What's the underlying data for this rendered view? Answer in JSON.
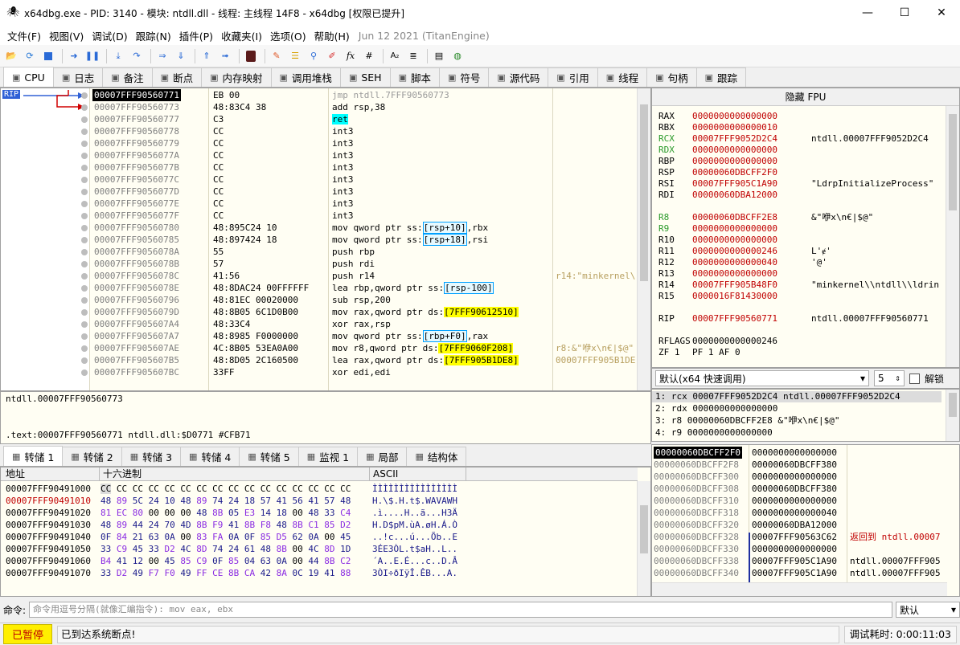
{
  "window": {
    "title": "x64dbg.exe - PID: 3140 - 模块: ntdll.dll - 线程: 主线程 14F8 - x64dbg [权限已提升]",
    "minimize": "—",
    "maximize": "☐",
    "close": "✕"
  },
  "menu": {
    "items": [
      "文件(F)",
      "视图(V)",
      "调试(D)",
      "跟踪(N)",
      "插件(P)",
      "收藏夹(I)",
      "选项(O)",
      "帮助(H)"
    ],
    "date": "Jun 12 2021 (TitanEngine)"
  },
  "toolbar": {
    "icons": [
      "open-icon",
      "restart-icon",
      "stop-icon",
      "run-icon",
      "pause-icon",
      "step-into-icon",
      "step-over-icon",
      "trace-into-icon",
      "trace-over-icon",
      "run-to-user-icon",
      "execute-till-return-icon",
      "scylla-icon",
      "hide-icon",
      "comment-icon",
      "label-icon",
      "bookmark-icon",
      "function-icon",
      "hash-icon",
      "strings-icon",
      "patch-icon",
      "calc-icon"
    ]
  },
  "tabs": [
    {
      "label": "CPU",
      "icon": "cpu-icon"
    },
    {
      "label": "日志",
      "icon": "log-icon"
    },
    {
      "label": "备注",
      "icon": "notes-icon"
    },
    {
      "label": "断点",
      "icon": "breakpoint-icon"
    },
    {
      "label": "内存映射",
      "icon": "memory-icon"
    },
    {
      "label": "调用堆栈",
      "icon": "callstack-icon"
    },
    {
      "label": "SEH",
      "icon": "seh-icon"
    },
    {
      "label": "脚本",
      "icon": "script-icon"
    },
    {
      "label": "符号",
      "icon": "symbol-icon"
    },
    {
      "label": "源代码",
      "icon": "source-icon"
    },
    {
      "label": "引用",
      "icon": "reference-icon"
    },
    {
      "label": "线程",
      "icon": "thread-icon"
    },
    {
      "label": "句柄",
      "icon": "handle-icon"
    },
    {
      "label": "跟踪",
      "icon": "trace-icon"
    }
  ],
  "disasm": {
    "rip_label": "RIP",
    "rows": [
      {
        "addr": "00007FFF90560771",
        "bytes": "EB 00",
        "instr": "jmp ntdll.7FFF90560773",
        "comment": "",
        "cur": true
      },
      {
        "addr": "00007FFF90560773",
        "bytes": "48:83C4 38",
        "instr": "add rsp,38",
        "comment": ""
      },
      {
        "addr": "00007FFF90560777",
        "bytes": "C3",
        "instr": "ret",
        "comment": ""
      },
      {
        "addr": "00007FFF90560778",
        "bytes": "CC",
        "instr": "int3",
        "comment": ""
      },
      {
        "addr": "00007FFF90560779",
        "bytes": "CC",
        "instr": "int3",
        "comment": ""
      },
      {
        "addr": "00007FFF9056077A",
        "bytes": "CC",
        "instr": "int3",
        "comment": ""
      },
      {
        "addr": "00007FFF9056077B",
        "bytes": "CC",
        "instr": "int3",
        "comment": ""
      },
      {
        "addr": "00007FFF9056077C",
        "bytes": "CC",
        "instr": "int3",
        "comment": ""
      },
      {
        "addr": "00007FFF9056077D",
        "bytes": "CC",
        "instr": "int3",
        "comment": ""
      },
      {
        "addr": "00007FFF9056077E",
        "bytes": "CC",
        "instr": "int3",
        "comment": ""
      },
      {
        "addr": "00007FFF9056077F",
        "bytes": "CC",
        "instr": "int3",
        "comment": ""
      },
      {
        "addr": "00007FFF90560780",
        "bytes": "48:895C24 10",
        "instr": "mov qword ptr ss:[rsp+10],rbx",
        "comment": ""
      },
      {
        "addr": "00007FFF90560785",
        "bytes": "48:897424 18",
        "instr": "mov qword ptr ss:[rsp+18],rsi",
        "comment": ""
      },
      {
        "addr": "00007FFF9056078A",
        "bytes": "55",
        "instr": "push rbp",
        "comment": ""
      },
      {
        "addr": "00007FFF9056078B",
        "bytes": "57",
        "instr": "push rdi",
        "comment": ""
      },
      {
        "addr": "00007FFF9056078C",
        "bytes": "41:56",
        "instr": "push r14",
        "comment": "r14:\"minkernel\\"
      },
      {
        "addr": "00007FFF9056078E",
        "bytes": "48:8DAC24 00FFFFFF",
        "instr": "lea rbp,qword ptr ss:[rsp-100]",
        "comment": ""
      },
      {
        "addr": "00007FFF90560796",
        "bytes": "48:81EC 00020000",
        "instr": "sub rsp,200",
        "comment": ""
      },
      {
        "addr": "00007FFF9056079D",
        "bytes": "48:8B05 6C1D0B00",
        "instr": "mov rax,qword ptr ds:[7FFF90612510]",
        "comment": ""
      },
      {
        "addr": "00007FFF905607A4",
        "bytes": "48:33C4",
        "instr": "xor rax,rsp",
        "comment": ""
      },
      {
        "addr": "00007FFF905607A7",
        "bytes": "48:8985 F0000000",
        "instr": "mov qword ptr ss:[rbp+F0],rax",
        "comment": ""
      },
      {
        "addr": "00007FFF905607AE",
        "bytes": "4C:8B05 53EA0A00",
        "instr": "mov r8,qword ptr ds:[7FFF9060F208]",
        "comment": "r8:&\"咿x\\n€|$@\""
      },
      {
        "addr": "00007FFF905607B5",
        "bytes": "48:8D05 2C160500",
        "instr": "lea rax,qword ptr ds:[7FFF905B1DE8]",
        "comment": "00007FFF905B1DE"
      },
      {
        "addr": "00007FFF905607BC",
        "bytes": "33FF",
        "instr": "xor edi,edi",
        "comment": ""
      }
    ]
  },
  "registers": {
    "header": "隐藏 FPU",
    "rows": [
      {
        "name": "RAX",
        "val": "0000000000000000",
        "desc": "",
        "chg": false
      },
      {
        "name": "RBX",
        "val": "0000000000000010",
        "desc": "",
        "chg": false
      },
      {
        "name": "RCX",
        "val": "00007FFF9052D2C4",
        "desc": "ntdll.00007FFF9052D2C4",
        "chg": true
      },
      {
        "name": "RDX",
        "val": "0000000000000000",
        "desc": "",
        "chg": true
      },
      {
        "name": "RBP",
        "val": "0000000000000000",
        "desc": "",
        "chg": false
      },
      {
        "name": "RSP",
        "val": "00000060DBCFF2F0",
        "desc": "",
        "chg": false
      },
      {
        "name": "RSI",
        "val": "00007FFF905C1A90",
        "desc": "\"LdrpInitializeProcess\"",
        "chg": false
      },
      {
        "name": "RDI",
        "val": "00000060DBA12000",
        "desc": "",
        "chg": false
      },
      {
        "name": "",
        "val": "",
        "desc": "",
        "chg": false
      },
      {
        "name": "R8",
        "val": "00000060DBCFF2E8",
        "desc": "&\"咿x\\n€|$@\"",
        "chg": true
      },
      {
        "name": "R9",
        "val": "0000000000000000",
        "desc": "",
        "chg": true
      },
      {
        "name": "R10",
        "val": "0000000000000000",
        "desc": "",
        "chg": false
      },
      {
        "name": "R11",
        "val": "0000000000000246",
        "desc": "L'ɇ'",
        "chg": false
      },
      {
        "name": "R12",
        "val": "0000000000000040",
        "desc": "'@'",
        "chg": false
      },
      {
        "name": "R13",
        "val": "0000000000000000",
        "desc": "",
        "chg": false
      },
      {
        "name": "R14",
        "val": "00007FFF905B48F0",
        "desc": "\"minkernel\\\\ntdll\\\\ldrin",
        "chg": false
      },
      {
        "name": "R15",
        "val": "0000016F81430000",
        "desc": "",
        "chg": false
      },
      {
        "name": "",
        "val": "",
        "desc": "",
        "chg": false
      },
      {
        "name": "RIP",
        "val": "00007FFF90560771",
        "desc": "ntdll.00007FFF90560771",
        "chg": false
      },
      {
        "name": "",
        "val": "",
        "desc": "",
        "chg": false
      },
      {
        "name": "RFLAGS",
        "val": "0000000000000246",
        "desc": "",
        "chg": false
      },
      {
        "name": "ZF 1",
        "val": "PF 1  AF 0",
        "desc": "",
        "chg": false
      }
    ]
  },
  "callconv": {
    "selected": "默认(x64 快速调用)",
    "count": "5",
    "unlocked": "解锁"
  },
  "args": [
    "1: rcx 00007FFF9052D2C4 ntdll.00007FFF9052D2C4",
    "2: rdx 0000000000000000",
    "3: r8 00000060DBCFF2E8 &\"咿x\\n€|$@\"",
    "4: r9 0000000000000000"
  ],
  "info": {
    "line1": "ntdll.00007FFF90560773",
    "line2": ".text:00007FFF90560771 ntdll.dll:$D0771 #CFB71"
  },
  "dumptabs": [
    {
      "label": "转储 1",
      "icon": "dump-icon"
    },
    {
      "label": "转储 2",
      "icon": "dump-icon"
    },
    {
      "label": "转储 3",
      "icon": "dump-icon"
    },
    {
      "label": "转储 4",
      "icon": "dump-icon"
    },
    {
      "label": "转储 5",
      "icon": "dump-icon"
    },
    {
      "label": "监视 1",
      "icon": "watch-icon"
    },
    {
      "label": "局部",
      "icon": "locals-icon"
    },
    {
      "label": "结构体",
      "icon": "struct-icon"
    }
  ],
  "dump": {
    "headers": {
      "addr": "地址",
      "hex": "十六进制",
      "ascii": "ASCII"
    },
    "rows": [
      {
        "addr": "00007FFF90491000",
        "hex": "CC CC CC CC CC CC CC CC CC CC CC CC CC CC CC CC",
        "ascii": "ÌÌÌÌÌÌÌÌÌÌÌÌÌÌÌÌ"
      },
      {
        "addr": "00007FFF90491010",
        "hex": "48 89 5C 24 10 48 89 74 24 18 57 41 56 41 57 48",
        "ascii": "H.\\$.H.t$.WAVAWH"
      },
      {
        "addr": "00007FFF90491020",
        "hex": "81 EC 80 00 00 00 48 8B 05 E3 14 18 00 48 33 C4",
        "ascii": ".ì....H..ã...H3Ä"
      },
      {
        "addr": "00007FFF90491030",
        "hex": "48 89 44 24 70 4D 8B F9 41 8B F8 48 8B C1 85 D2",
        "ascii": "H.D$pM.ùA.øH.Á.Ò"
      },
      {
        "addr": "00007FFF90491040",
        "hex": "0F 84 21 63 0A 00 83 FA 0A 0F 85 D5 62 0A 00 45",
        "ascii": "..!c...ú...Õb..E"
      },
      {
        "addr": "00007FFF90491050",
        "hex": "33 C9 45 33 D2 4C 8D 74 24 61 48 8B 00 4C 8D 1D",
        "ascii": "3ÉE3ÒL.t$aH..L.."
      },
      {
        "addr": "00007FFF90491060",
        "hex": "B4 41 12 00 45 85 C9 0F 85 04 63 0A 00 44 8B C2",
        "ascii": "´A..E.É...c..D.Â"
      },
      {
        "addr": "00007FFF90491070",
        "hex": "33 D2 49 F7 F0 49 FF CE 8B CA 42 8A 0C 19 41 88",
        "ascii": "3ÒI÷ðIÿÎ.ÊB...A."
      }
    ]
  },
  "stack": {
    "rows": [
      {
        "addr": "00000060DBCFF2F0",
        "val": "0000000000000000",
        "cmt": "",
        "cur": true
      },
      {
        "addr": "00000060DBCFF2F8",
        "val": "00000060DBCFF380",
        "cmt": "",
        "cur": false
      },
      {
        "addr": "00000060DBCFF300",
        "val": "0000000000000000",
        "cmt": "",
        "cur": false
      },
      {
        "addr": "00000060DBCFF308",
        "val": "00000060DBCFF380",
        "cmt": "",
        "cur": false
      },
      {
        "addr": "00000060DBCFF310",
        "val": "0000000000000000",
        "cmt": "",
        "cur": false
      },
      {
        "addr": "00000060DBCFF318",
        "val": "0000000000000040",
        "cmt": "",
        "cur": false
      },
      {
        "addr": "00000060DBCFF320",
        "val": "00000060DBA12000",
        "cmt": "",
        "cur": false
      },
      {
        "addr": "00000060DBCFF328",
        "val": "00007FFF90563C62",
        "cmt": "返回到 ntdll.00007",
        "cur": false
      },
      {
        "addr": "00000060DBCFF330",
        "val": "0000000000000000",
        "cmt": "",
        "cur": false
      },
      {
        "addr": "00000060DBCFF338",
        "val": "00007FFF905C1A90",
        "cmt": "ntdll.00007FFF905",
        "cur": false
      },
      {
        "addr": "00000060DBCFF340",
        "val": "00007FFF905C1A90",
        "cmt": "ntdll.00007FFF905",
        "cur": false
      }
    ]
  },
  "cmd": {
    "label": "命令:",
    "placeholder": "命令用逗号分隔(就像汇编指令): mov eax, ebx",
    "mode": "默认"
  },
  "status": {
    "paused": "已暂停",
    "message": "已到达系统断点!",
    "time": "调试耗时:  0:00:11:03"
  }
}
